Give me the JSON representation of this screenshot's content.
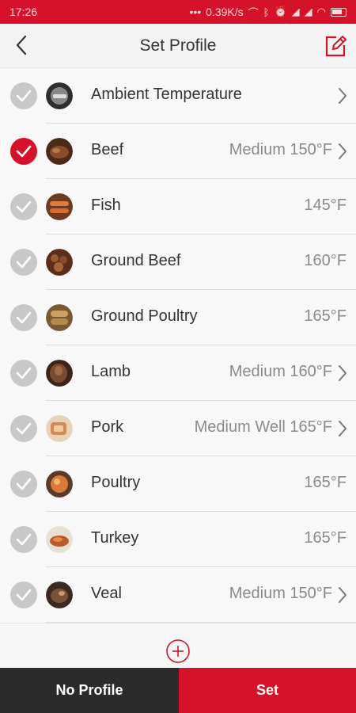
{
  "status_bar": {
    "time": "17:26",
    "dots": "•••",
    "net_speed": "0.39K/s",
    "bg_color": "#d6112a"
  },
  "header": {
    "title": "Set Profile",
    "back_icon": "chevron-left-icon",
    "edit_icon": "edit-icon"
  },
  "profiles": [
    {
      "label": "Ambient Temperature",
      "value": "",
      "chevron": true,
      "selected": false,
      "thumb": "ambient"
    },
    {
      "label": "Beef",
      "value": "Medium 150°F",
      "chevron": true,
      "selected": true,
      "thumb": "beef"
    },
    {
      "label": "Fish",
      "value": "145°F",
      "chevron": false,
      "selected": false,
      "thumb": "fish"
    },
    {
      "label": "Ground Beef",
      "value": "160°F",
      "chevron": false,
      "selected": false,
      "thumb": "groundbeef"
    },
    {
      "label": "Ground Poultry",
      "value": "165°F",
      "chevron": false,
      "selected": false,
      "thumb": "groundpoultry"
    },
    {
      "label": "Lamb",
      "value": "Medium 160°F",
      "chevron": true,
      "selected": false,
      "thumb": "lamb"
    },
    {
      "label": "Pork",
      "value": "Medium Well 165°F",
      "chevron": true,
      "selected": false,
      "thumb": "pork"
    },
    {
      "label": "Poultry",
      "value": "165°F",
      "chevron": false,
      "selected": false,
      "thumb": "poultry"
    },
    {
      "label": "Turkey",
      "value": "165°F",
      "chevron": false,
      "selected": false,
      "thumb": "turkey"
    },
    {
      "label": "Veal",
      "value": "Medium 150°F",
      "chevron": true,
      "selected": false,
      "thumb": "veal"
    }
  ],
  "add_icon": "plus-circle-icon",
  "footer": {
    "no_profile_label": "No Profile",
    "set_label": "Set"
  },
  "colors": {
    "accent": "#d6112a",
    "dark": "#2b2b2b",
    "check_off": "#c8c8c8"
  }
}
